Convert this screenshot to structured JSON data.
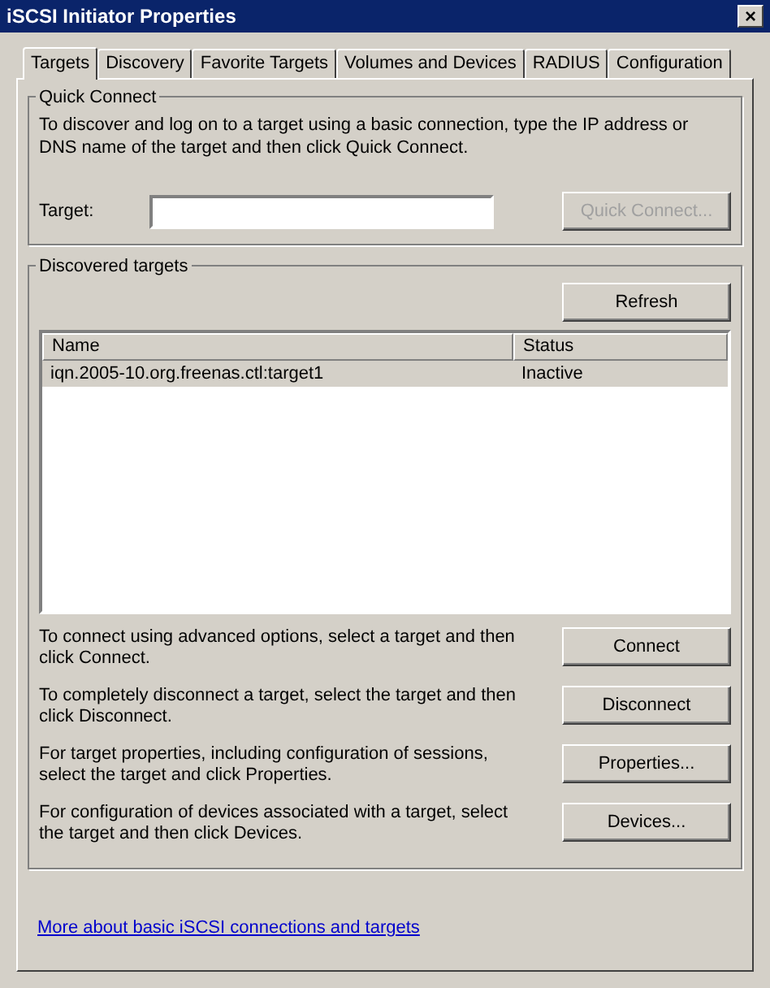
{
  "window": {
    "title": "iSCSI Initiator Properties",
    "close": "×"
  },
  "tabs": [
    {
      "label": "Targets",
      "selected": true
    },
    {
      "label": "Discovery",
      "selected": false
    },
    {
      "label": "Favorite Targets",
      "selected": false
    },
    {
      "label": "Volumes and Devices",
      "selected": false
    },
    {
      "label": "RADIUS",
      "selected": false
    },
    {
      "label": "Configuration",
      "selected": false
    }
  ],
  "quick_connect": {
    "title": "Quick Connect",
    "description": "To discover and log on to a target using a basic connection, type the IP address or DNS name of the target and then click Quick Connect.",
    "target_label": "Target:",
    "button": {
      "label": "Quick Connect...",
      "disabled": true
    }
  },
  "discovered_targets": {
    "title": "Discovered targets",
    "refresh_button": "Refresh",
    "table": {
      "columns": [
        "Name",
        "Status"
      ],
      "rows": [
        {
          "cells": [
            "iqn.2005-10.org.freenas.ctl:target1",
            "Inactive"
          ],
          "selected": true
        }
      ]
    },
    "actions": [
      {
        "description": "To connect using advanced options, select a target and then click Connect.",
        "button": "Connect"
      },
      {
        "description": "To completely disconnect a target, select the target and then click Disconnect.",
        "button": "Disconnect"
      },
      {
        "description": "For target properties, including configuration of sessions, select the target and click Properties.",
        "button": "Properties..."
      },
      {
        "description": "For configuration of devices associated with a target, select the target and then click Devices.",
        "button": "Devices..."
      }
    ]
  },
  "link": "More about basic iSCSI connections and targets"
}
